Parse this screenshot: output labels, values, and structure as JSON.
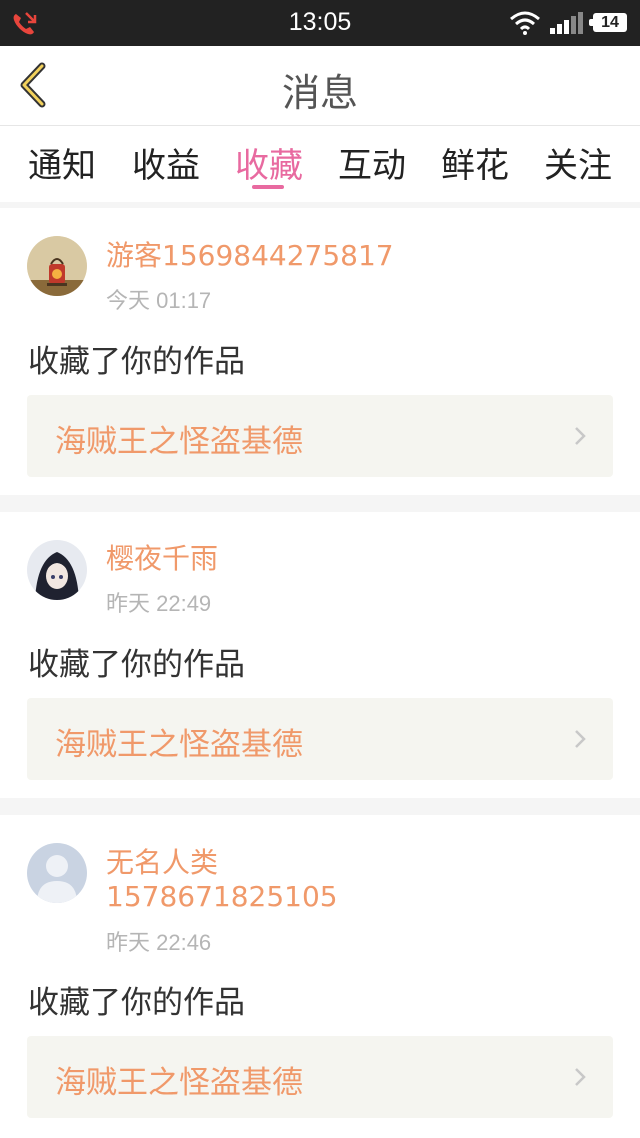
{
  "status_bar": {
    "time": "13:05",
    "battery": "14",
    "icons": [
      "missed-call-icon",
      "wifi-icon",
      "signal-icon",
      "battery-icon"
    ]
  },
  "header": {
    "title": "消息",
    "back_icon": "chevron-left-icon"
  },
  "tabs": [
    {
      "label": "通知",
      "active": false
    },
    {
      "label": "收益",
      "active": false
    },
    {
      "label": "收藏",
      "active": true
    },
    {
      "label": "互动",
      "active": false
    },
    {
      "label": "鲜花",
      "active": false
    },
    {
      "label": "关注",
      "active": false
    }
  ],
  "colors": {
    "accent": "#e86aa0",
    "username": "#f0996a",
    "status_bar": "#222222"
  },
  "messages": [
    {
      "username": "游客1569844275817",
      "time": "今天 01:17",
      "action": "收藏了你的作品",
      "work_title": "海贼王之怪盗基德"
    },
    {
      "username": "樱夜千雨",
      "time": "昨天 22:49",
      "action": "收藏了你的作品",
      "work_title": "海贼王之怪盗基德"
    },
    {
      "username": "无名人类1578671825105",
      "time": "昨天 22:46",
      "action": "收藏了你的作品",
      "work_title": "海贼王之怪盗基德"
    }
  ]
}
